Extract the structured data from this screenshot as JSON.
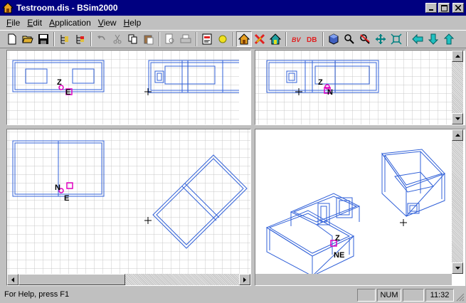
{
  "window": {
    "title": "Testroom.dis - BSim2000",
    "buttons": [
      "minimize",
      "maximize",
      "close"
    ]
  },
  "menubar": {
    "items": [
      {
        "label": "File",
        "key": "F",
        "rest": "ile"
      },
      {
        "label": "Edit",
        "key": "E",
        "rest": "dit"
      },
      {
        "label": "Application",
        "key": "A",
        "rest": "pplication"
      },
      {
        "label": "View",
        "key": "V",
        "rest": "iew"
      },
      {
        "label": "Help",
        "key": "H",
        "rest": "elp"
      }
    ]
  },
  "toolbar": {
    "buttons": [
      {
        "name": "new-file-icon"
      },
      {
        "name": "open-folder-icon"
      },
      {
        "name": "save-icon"
      },
      {
        "name": "tree-icon"
      },
      {
        "name": "tree-red-icon"
      },
      {
        "name": "undo-icon"
      },
      {
        "name": "cut-icon"
      },
      {
        "name": "copy-icon"
      },
      {
        "name": "paste-icon"
      },
      {
        "name": "print-preview-icon"
      },
      {
        "name": "print-icon"
      },
      {
        "name": "document-icon"
      },
      {
        "name": "sun-icon"
      },
      {
        "name": "house-icon"
      },
      {
        "name": "cross-icon"
      },
      {
        "name": "house-teal-icon"
      },
      {
        "name": "bv-icon",
        "text": "BV"
      },
      {
        "name": "db-icon",
        "text": "DB"
      },
      {
        "name": "cube-icon"
      },
      {
        "name": "zoom-icon"
      },
      {
        "name": "zoom-cancel-icon"
      },
      {
        "name": "pan-icon"
      },
      {
        "name": "fit-icon"
      },
      {
        "name": "arrow-left-icon"
      },
      {
        "name": "arrow-down-icon"
      },
      {
        "name": "arrow-up-icon"
      }
    ],
    "pressed": "house-icon"
  },
  "views": {
    "top_left": {
      "labels": {
        "z": "Z",
        "e": "E"
      }
    },
    "top_right": {
      "labels": {
        "z": "Z",
        "n": "N"
      }
    },
    "bottom_left": {
      "labels": {
        "n": "N",
        "e": "E"
      }
    },
    "bottom_right": {
      "labels": {
        "z": "Z",
        "ne": "NE"
      }
    }
  },
  "statusbar": {
    "help_text": "For Help, press F1",
    "num": "NUM",
    "time": "11:32"
  },
  "colors": {
    "titlebar": "#000080",
    "model_lines": "#3060d8",
    "marker": "#e000c0",
    "grid": "#c8c8c8"
  }
}
